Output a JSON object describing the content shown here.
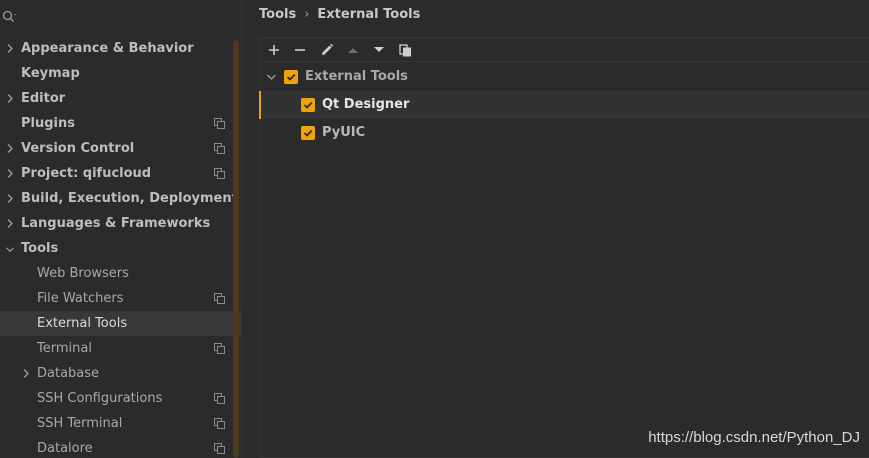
{
  "search": {
    "icon": "search-icon"
  },
  "sidebar": {
    "items": [
      {
        "label": "Appearance & Behavior",
        "level": 0,
        "expandable": true,
        "expanded": false,
        "copy_icon": false
      },
      {
        "label": "Keymap",
        "level": 0,
        "expandable": false,
        "copy_icon": false
      },
      {
        "label": "Editor",
        "level": 0,
        "expandable": true,
        "expanded": false,
        "copy_icon": false
      },
      {
        "label": "Plugins",
        "level": 0,
        "expandable": false,
        "copy_icon": true
      },
      {
        "label": "Version Control",
        "level": 0,
        "expandable": true,
        "expanded": false,
        "copy_icon": true
      },
      {
        "label": "Project: qifucloud",
        "level": 0,
        "expandable": true,
        "expanded": false,
        "copy_icon": true
      },
      {
        "label": "Build, Execution, Deployment",
        "level": 0,
        "expandable": true,
        "expanded": false,
        "copy_icon": false
      },
      {
        "label": "Languages & Frameworks",
        "level": 0,
        "expandable": true,
        "expanded": false,
        "copy_icon": false
      },
      {
        "label": "Tools",
        "level": 0,
        "expandable": true,
        "expanded": true,
        "copy_icon": false
      },
      {
        "label": "Web Browsers",
        "level": 1,
        "expandable": false,
        "copy_icon": false
      },
      {
        "label": "File Watchers",
        "level": 1,
        "expandable": false,
        "copy_icon": true
      },
      {
        "label": "External Tools",
        "level": 1,
        "expandable": false,
        "copy_icon": false,
        "selected": true
      },
      {
        "label": "Terminal",
        "level": 1,
        "expandable": false,
        "copy_icon": true
      },
      {
        "label": "Database",
        "level": 1,
        "expandable": true,
        "expanded": false,
        "copy_icon": false
      },
      {
        "label": "SSH Configurations",
        "level": 1,
        "expandable": false,
        "copy_icon": true
      },
      {
        "label": "SSH Terminal",
        "level": 1,
        "expandable": false,
        "copy_icon": true
      },
      {
        "label": "Datalore",
        "level": 1,
        "expandable": false,
        "copy_icon": true
      }
    ]
  },
  "breadcrumb": {
    "parent": "Tools",
    "separator": "›",
    "current": "External Tools"
  },
  "toolbar": {
    "buttons": [
      "add-icon",
      "remove-icon",
      "edit-icon",
      "move-up-icon",
      "move-down-icon",
      "copy-icon"
    ]
  },
  "tools_list": {
    "group": {
      "label": "External Tools",
      "checked": true,
      "expanded": true
    },
    "items": [
      {
        "label": "Qt Designer",
        "checked": true,
        "selected": true
      },
      {
        "label": "PyUIC",
        "checked": true,
        "selected": false
      }
    ]
  },
  "watermark": {
    "text": "https://blog.csdn.net/Python_DJ"
  },
  "colors": {
    "background": "#2b2b2b",
    "accent": "#f0a30a",
    "selection": "#383838",
    "text": "#bbbbbb"
  }
}
